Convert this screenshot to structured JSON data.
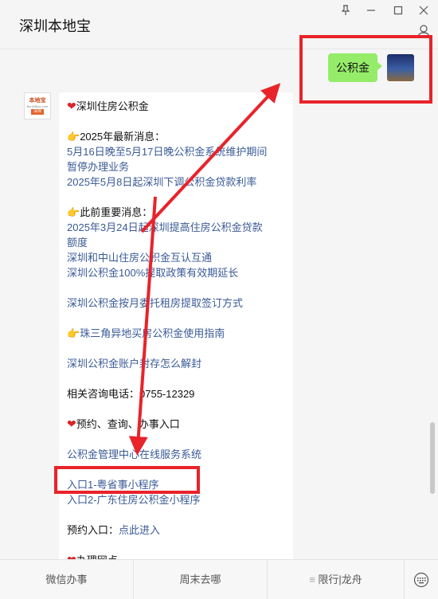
{
  "window": {
    "title": "深圳本地宝",
    "pin_icon": "pin-icon",
    "minimize_icon": "minimize-icon",
    "maximize_icon": "maximize-icon",
    "close_icon": "close-icon",
    "profile_icon": "person-icon"
  },
  "outgoing": {
    "text": "公积金"
  },
  "bot": {
    "avatar_text_1": "本地宝",
    "avatar_text_2": "BenDiBao.com",
    "avatar_text_3": "深圳"
  },
  "message": {
    "title": "深圳住房公积金",
    "latest_heading": "2025年最新消息：",
    "latest": [
      "5月16日晚至5月17日晚公积金系统维护期间",
      "暂停办理业务",
      "2025年5月8日起深圳下调公积金贷款利率"
    ],
    "prev_heading": "此前重要消息：",
    "prev": [
      "2025年3月24日起深圳提高住房公积金贷款",
      "额度",
      "深圳和中山住房公积金互认互通",
      "深圳公积金100%提取政策有效期延长"
    ],
    "rent_link": "深圳公积金按月委托租房提取签订方式",
    "pearl_link": "珠三角异地买房公积金使用指南",
    "seal_link": "深圳公积金账户封存怎么解封",
    "phone_label": "相关咨询电话：",
    "phone": "0755-12329",
    "entry_heading": "预约、查询、办事入口",
    "center_link": "公积金管理中心在线服务系统",
    "entry1": "入口1-粤省事小程序",
    "entry2": "入口2-广东住房公积金小程序",
    "appt_label": "预约入口：",
    "appt_link": "点此进入",
    "cut_heading": "办理网点"
  },
  "bottom_menu": {
    "items": [
      "微信办事",
      "周末去哪",
      "限行|龙舟"
    ],
    "keyboard_icon": "keyboard-icon"
  },
  "colors": {
    "accent_green": "#95ec69",
    "link": "#3a5a96",
    "annotation_red": "#e8232a"
  }
}
